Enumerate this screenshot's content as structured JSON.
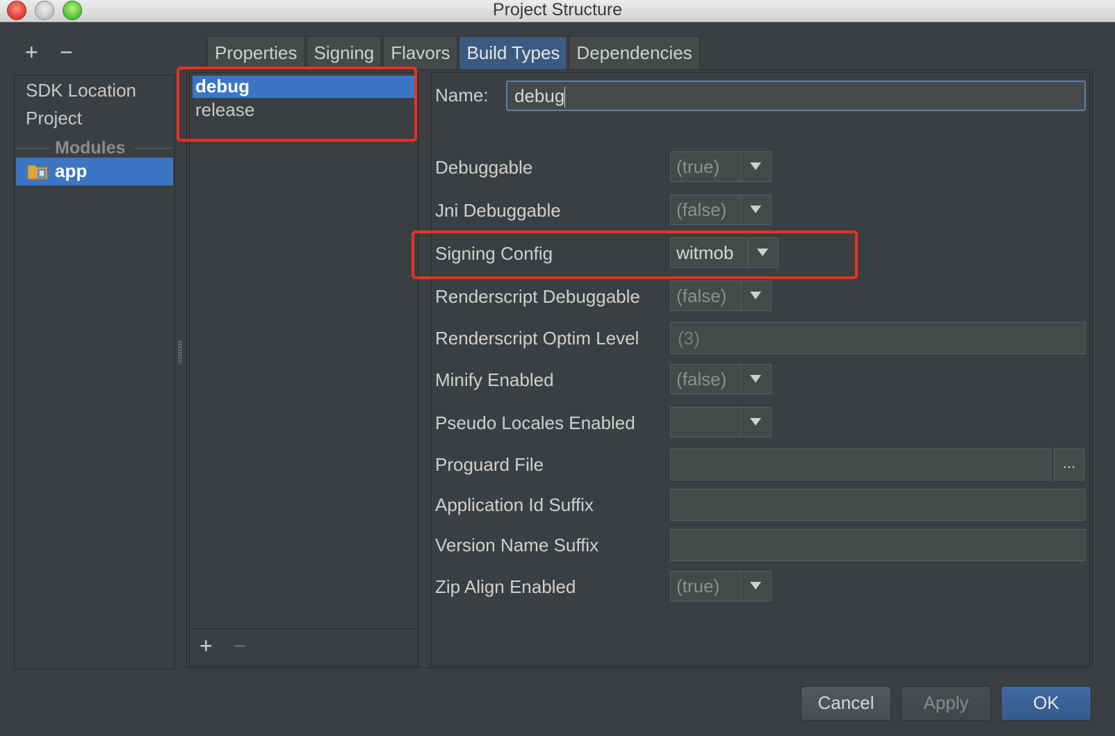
{
  "window": {
    "title": "Project Structure"
  },
  "toolbar": {
    "add": "+",
    "remove": "−"
  },
  "sidebar": {
    "items": [
      {
        "label": "SDK Location"
      },
      {
        "label": "Project"
      }
    ],
    "section_label": "Modules",
    "modules": [
      {
        "label": "app"
      }
    ]
  },
  "tabs": [
    {
      "label": "Properties"
    },
    {
      "label": "Signing"
    },
    {
      "label": "Flavors"
    },
    {
      "label": "Build Types"
    },
    {
      "label": "Dependencies"
    }
  ],
  "build_types": [
    {
      "label": "debug"
    },
    {
      "label": "release"
    }
  ],
  "list_footer": {
    "add": "+",
    "remove": "−"
  },
  "form": {
    "name_label": "Name:",
    "name_value": "debug",
    "fields": [
      {
        "label": "Debuggable",
        "value": "(true)"
      },
      {
        "label": "Jni Debuggable",
        "value": "(false)"
      },
      {
        "label": "Signing Config",
        "value": "witmob"
      },
      {
        "label": "Renderscript Debuggable",
        "value": "(false)"
      },
      {
        "label": "Renderscript Optim Level",
        "value": "(3)"
      },
      {
        "label": "Minify Enabled",
        "value": "(false)"
      },
      {
        "label": "Pseudo Locales Enabled",
        "value": ""
      },
      {
        "label": "Proguard File",
        "value": ""
      },
      {
        "label": "Application Id Suffix",
        "value": ""
      },
      {
        "label": "Version Name Suffix",
        "value": ""
      },
      {
        "label": "Zip Align Enabled",
        "value": "(true)"
      }
    ],
    "browse_label": "..."
  },
  "buttons": {
    "cancel": "Cancel",
    "apply": "Apply",
    "ok": "OK"
  },
  "colors": {
    "selection": "#3b75c4",
    "highlight": "#e8321f",
    "background": "#3c3f41"
  }
}
